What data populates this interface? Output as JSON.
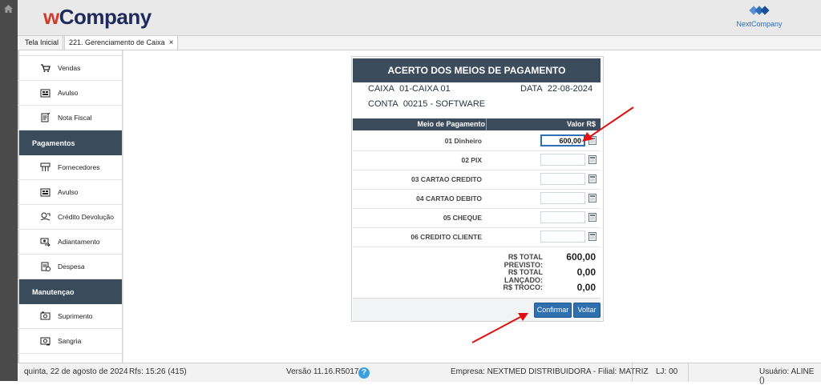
{
  "header": {
    "logo_w": "w",
    "logo_rest": "Company",
    "partner_logo_text": "NextCompany"
  },
  "tabs": [
    {
      "label": "Tela Inicial"
    },
    {
      "label": "221. Gerenciamento de Caixa",
      "close": "×"
    }
  ],
  "sidebar": {
    "items_top": [
      {
        "label": "Vendas",
        "icon": "cart-icon"
      },
      {
        "label": "Avulso",
        "icon": "register-icon"
      },
      {
        "label": "Nota Fiscal",
        "icon": "invoice-icon"
      }
    ],
    "section_payments": "Pagamentos",
    "items_payments": [
      {
        "label": "Fornecedores",
        "icon": "supplier-icon"
      },
      {
        "label": "Avulso",
        "icon": "register-icon"
      },
      {
        "label": "Crédito Devolução",
        "icon": "credit-return-icon"
      },
      {
        "label": "Adiantamento",
        "icon": "advance-icon"
      },
      {
        "label": "Despesa",
        "icon": "expense-icon"
      }
    ],
    "section_maint": "Manutençao",
    "items_maint": [
      {
        "label": "Suprimento",
        "icon": "cash-in-icon"
      },
      {
        "label": "Sangria",
        "icon": "cash-out-icon"
      }
    ]
  },
  "panel": {
    "title": "ACERTO DOS MEIOS DE PAGAMENTO",
    "caixa_label": "CAIXA",
    "caixa_value": "01-CAIXA 01",
    "data_label": "DATA",
    "data_value": "22-08-2024",
    "conta_label": "CONTA",
    "conta_value": "00215 - SOFTWARE",
    "col_method": "Meio de Pagamento",
    "col_value": "Valor R$",
    "rows": [
      {
        "label": "01 Dinheiro",
        "value": "600,00"
      },
      {
        "label": "02 PIX",
        "value": ""
      },
      {
        "label": "03 CARTAO CREDITO",
        "value": ""
      },
      {
        "label": "04 CARTAO DEBITO",
        "value": ""
      },
      {
        "label": "05 CHEQUE",
        "value": ""
      },
      {
        "label": "06 CREDITO CLIENTE",
        "value": ""
      }
    ],
    "totals": [
      {
        "label": "R$ TOTAL PREVISTO:",
        "value": "600,00"
      },
      {
        "label": "R$ TOTAL LANÇADO:",
        "value": "0,00"
      },
      {
        "label": "R$ TROCO:",
        "value": "0,00"
      }
    ],
    "confirm": "Confirmar",
    "back": "Voltar"
  },
  "status": {
    "date": "quinta, 22 de agosto de 2024",
    "rfs": "Rfs: 15:26 (415)",
    "version": "Versão 11.16.R5017",
    "help": "?",
    "company": "Empresa: NEXTMED DISTRIBUIDORA - Filial: MATRIZ",
    "lj": "LJ: 00",
    "user": "Usuário: ALINE ()"
  },
  "colors": {
    "header_dark": "#3d4c5c",
    "accent_blue": "#2f6fb0",
    "annotation_red": "#e01010"
  }
}
